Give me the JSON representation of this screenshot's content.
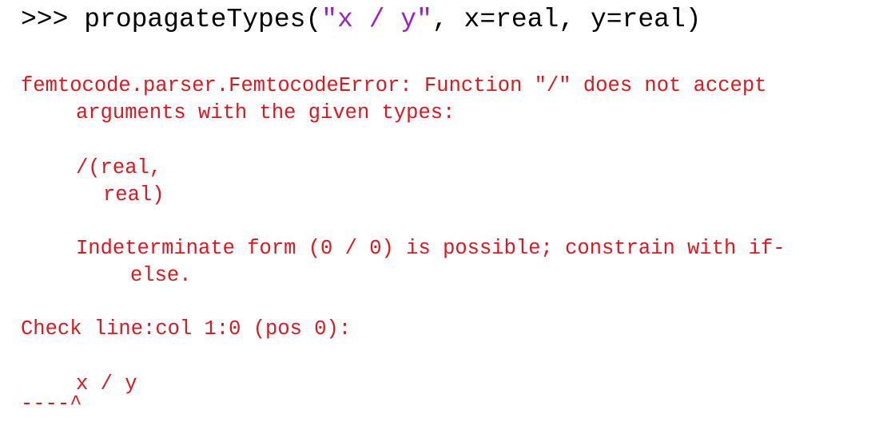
{
  "colors": {
    "text": "#000000",
    "string": "#a020c8",
    "error": "#e0161e",
    "background": "#ffffff"
  },
  "prompt": {
    "marker": ">>> ",
    "call_open": "propagateTypes(",
    "arg_string": "\"x / y\"",
    "call_rest": ", x=real, y=real)"
  },
  "error": {
    "line1": "femtocode.parser.FemtocodeError: Function \"/\" does not accept",
    "line2": "arguments with the given types:",
    "signature_line1": "/(real,",
    "signature_line2": "real)",
    "message_line1": "Indeterminate form (0 / 0) is possible; constrain with if-",
    "message_line2": "else.",
    "location": "Check line:col 1:0 (pos 0):",
    "source": "x / y",
    "caret": "----^"
  }
}
